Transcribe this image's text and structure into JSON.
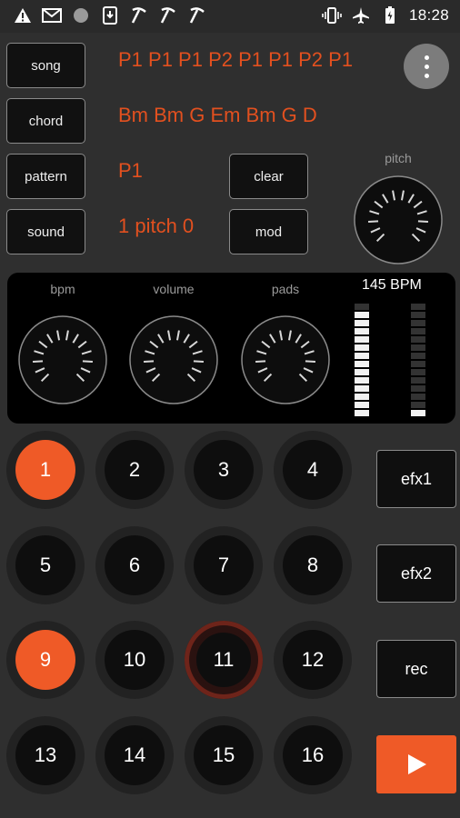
{
  "status_bar": {
    "left_icons": [
      "warning-icon",
      "gmail-icon",
      "circle-icon",
      "download-box-icon",
      "pickaxe-icon",
      "pickaxe-icon",
      "pickaxe-icon"
    ],
    "right_icons": [
      "vibrate-icon",
      "airplane-icon",
      "battery-icon"
    ],
    "time": "18:28"
  },
  "rows": [
    {
      "button": "song",
      "value": "P1 P1 P1 P2 P1 P1 P2 P1"
    },
    {
      "button": "chord",
      "value": "Bm Bm G Em Bm G D"
    },
    {
      "button": "pattern",
      "value": "P1"
    },
    {
      "button": "sound",
      "value": "1 pitch 0"
    }
  ],
  "controls": {
    "clear": "clear",
    "mod": "mod"
  },
  "pitch_knob": {
    "label": "pitch",
    "level": 0.5
  },
  "panel": {
    "knobs": [
      {
        "label": "bpm",
        "level": 0.5
      },
      {
        "label": "volume",
        "level": 0.5
      },
      {
        "label": "pads",
        "level": 0.5
      }
    ],
    "bpm_readout": "145 BPM",
    "meter_left_lit": 13,
    "meter_right_lit": 1,
    "meter_segments": 14
  },
  "pads": [
    {
      "label": "1",
      "active": true
    },
    {
      "label": "2",
      "active": false
    },
    {
      "label": "3",
      "active": false
    },
    {
      "label": "4",
      "active": false
    },
    {
      "label": "5",
      "active": false
    },
    {
      "label": "6",
      "active": false
    },
    {
      "label": "7",
      "active": false
    },
    {
      "label": "8",
      "active": false
    },
    {
      "label": "9",
      "active": true
    },
    {
      "label": "10",
      "active": false
    },
    {
      "label": "11",
      "active": false,
      "playing": true
    },
    {
      "label": "12",
      "active": false
    },
    {
      "label": "13",
      "active": false
    },
    {
      "label": "14",
      "active": false
    },
    {
      "label": "15",
      "active": false
    },
    {
      "label": "16",
      "active": false
    }
  ],
  "side_buttons": {
    "efx1": "efx1",
    "efx2": "efx2",
    "rec": "rec",
    "play": "play-icon"
  },
  "colors": {
    "accent": "#ef5a27",
    "text_accent": "#e2501f",
    "background": "#2f2f2f"
  }
}
